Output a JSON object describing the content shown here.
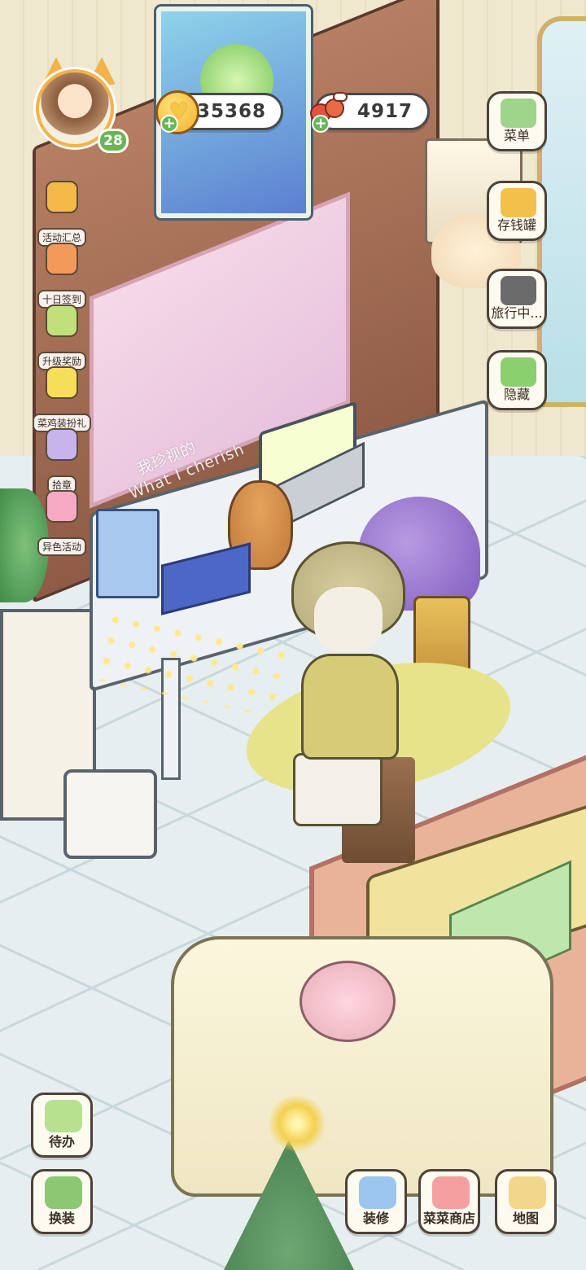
{
  "profile": {
    "level": "28"
  },
  "currencies": {
    "coins": {
      "value": "35368",
      "icon": "heart-coin-icon"
    },
    "food": {
      "value": "4917",
      "icon": "meat-icon"
    }
  },
  "left_menu": [
    {
      "label": "活动汇总",
      "icon": "event-summary-icon",
      "color": "#f5b94a"
    },
    {
      "label": "十日签到",
      "icon": "ten-day-checkin-icon",
      "color": "#f39a5a"
    },
    {
      "label": "升级奖励",
      "icon": "level-up-reward-icon",
      "color": "#bfe07a"
    },
    {
      "label": "菜鸡装扮礼",
      "icon": "chick-dressup-gift-icon",
      "color": "#f7de5a"
    },
    {
      "label": "拾章",
      "icon": "badge-collect-icon",
      "color": "#c7b4ec"
    },
    {
      "label": "异色活动",
      "icon": "rainbow-event-icon",
      "color": "#f5a9c3"
    }
  ],
  "right_menu": [
    {
      "label": "菜单",
      "icon": "menu-icon",
      "color": "#9fd58a"
    },
    {
      "label": "存钱罐",
      "icon": "piggy-bank-icon",
      "color": "#f3c04b"
    },
    {
      "label": "旅行中...",
      "icon": "camera-icon",
      "color": "#6b6b6b"
    },
    {
      "label": "隐藏",
      "icon": "hide-icon",
      "color": "#8bd06e"
    }
  ],
  "bottom_left": [
    {
      "label": "待办",
      "icon": "todo-list-icon",
      "color": "#b7e08f"
    },
    {
      "label": "换装",
      "icon": "change-outfit-icon",
      "color": "#8cc773"
    }
  ],
  "bottom_right": [
    {
      "label": "装修",
      "icon": "decorate-icon",
      "color": "#9cc6f0"
    },
    {
      "label": "菜菜商店",
      "icon": "shop-icon",
      "color": "#f5a0a0"
    },
    {
      "label": "地图",
      "icon": "map-icon",
      "color": "#f2d78a"
    }
  ],
  "scene": {
    "caption_zh": "我珍视的",
    "caption_en": "What I cherish"
  }
}
